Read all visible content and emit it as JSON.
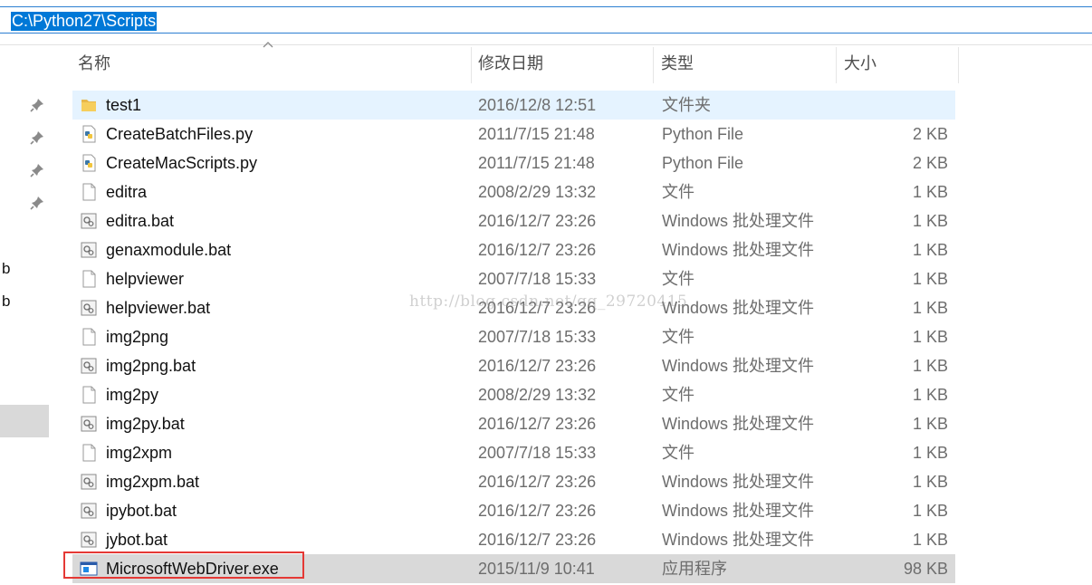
{
  "address_bar": {
    "path": "C:\\Python27\\Scripts"
  },
  "nav": {
    "letters": [
      "b",
      "b"
    ]
  },
  "columns": {
    "name": "名称",
    "date": "修改日期",
    "type": "类型",
    "size": "大小"
  },
  "files": [
    {
      "name": "test1",
      "date": "2016/12/8 12:51",
      "type": "文件夹",
      "size": "",
      "icon": "folder-icon"
    },
    {
      "name": "CreateBatchFiles.py",
      "date": "2011/7/15 21:48",
      "type": "Python File",
      "size": "2 KB",
      "icon": "python-file-icon"
    },
    {
      "name": "CreateMacScripts.py",
      "date": "2011/7/15 21:48",
      "type": "Python File",
      "size": "2 KB",
      "icon": "python-file-icon"
    },
    {
      "name": "editra",
      "date": "2008/2/29 13:32",
      "type": "文件",
      "size": "1 KB",
      "icon": "blank-file-icon"
    },
    {
      "name": "editra.bat",
      "date": "2016/12/7 23:26",
      "type": "Windows 批处理文件",
      "size": "1 KB",
      "icon": "batch-file-icon"
    },
    {
      "name": "genaxmodule.bat",
      "date": "2016/12/7 23:26",
      "type": "Windows 批处理文件",
      "size": "1 KB",
      "icon": "batch-file-icon"
    },
    {
      "name": "helpviewer",
      "date": "2007/7/18 15:33",
      "type": "文件",
      "size": "1 KB",
      "icon": "blank-file-icon"
    },
    {
      "name": "helpviewer.bat",
      "date": "2016/12/7 23:26",
      "type": "Windows 批处理文件",
      "size": "1 KB",
      "icon": "batch-file-icon"
    },
    {
      "name": "img2png",
      "date": "2007/7/18 15:33",
      "type": "文件",
      "size": "1 KB",
      "icon": "blank-file-icon"
    },
    {
      "name": "img2png.bat",
      "date": "2016/12/7 23:26",
      "type": "Windows 批处理文件",
      "size": "1 KB",
      "icon": "batch-file-icon"
    },
    {
      "name": "img2py",
      "date": "2008/2/29 13:32",
      "type": "文件",
      "size": "1 KB",
      "icon": "blank-file-icon"
    },
    {
      "name": "img2py.bat",
      "date": "2016/12/7 23:26",
      "type": "Windows 批处理文件",
      "size": "1 KB",
      "icon": "batch-file-icon"
    },
    {
      "name": "img2xpm",
      "date": "2007/7/18 15:33",
      "type": "文件",
      "size": "1 KB",
      "icon": "blank-file-icon"
    },
    {
      "name": "img2xpm.bat",
      "date": "2016/12/7 23:26",
      "type": "Windows 批处理文件",
      "size": "1 KB",
      "icon": "batch-file-icon"
    },
    {
      "name": "ipybot.bat",
      "date": "2016/12/7 23:26",
      "type": "Windows 批处理文件",
      "size": "1 KB",
      "icon": "batch-file-icon"
    },
    {
      "name": "jybot.bat",
      "date": "2016/12/7 23:26",
      "type": "Windows 批处理文件",
      "size": "1 KB",
      "icon": "batch-file-icon"
    },
    {
      "name": "MicrosoftWebDriver.exe",
      "date": "2015/11/9 10:41",
      "type": "应用程序",
      "size": "98 KB",
      "icon": "application-icon"
    }
  ],
  "watermark": "http://blog.csdn.net/qq_29720415",
  "colors": {
    "selection": "#0078d7",
    "row_hover": "#e5f3ff",
    "highlight_box": "#e53935"
  }
}
